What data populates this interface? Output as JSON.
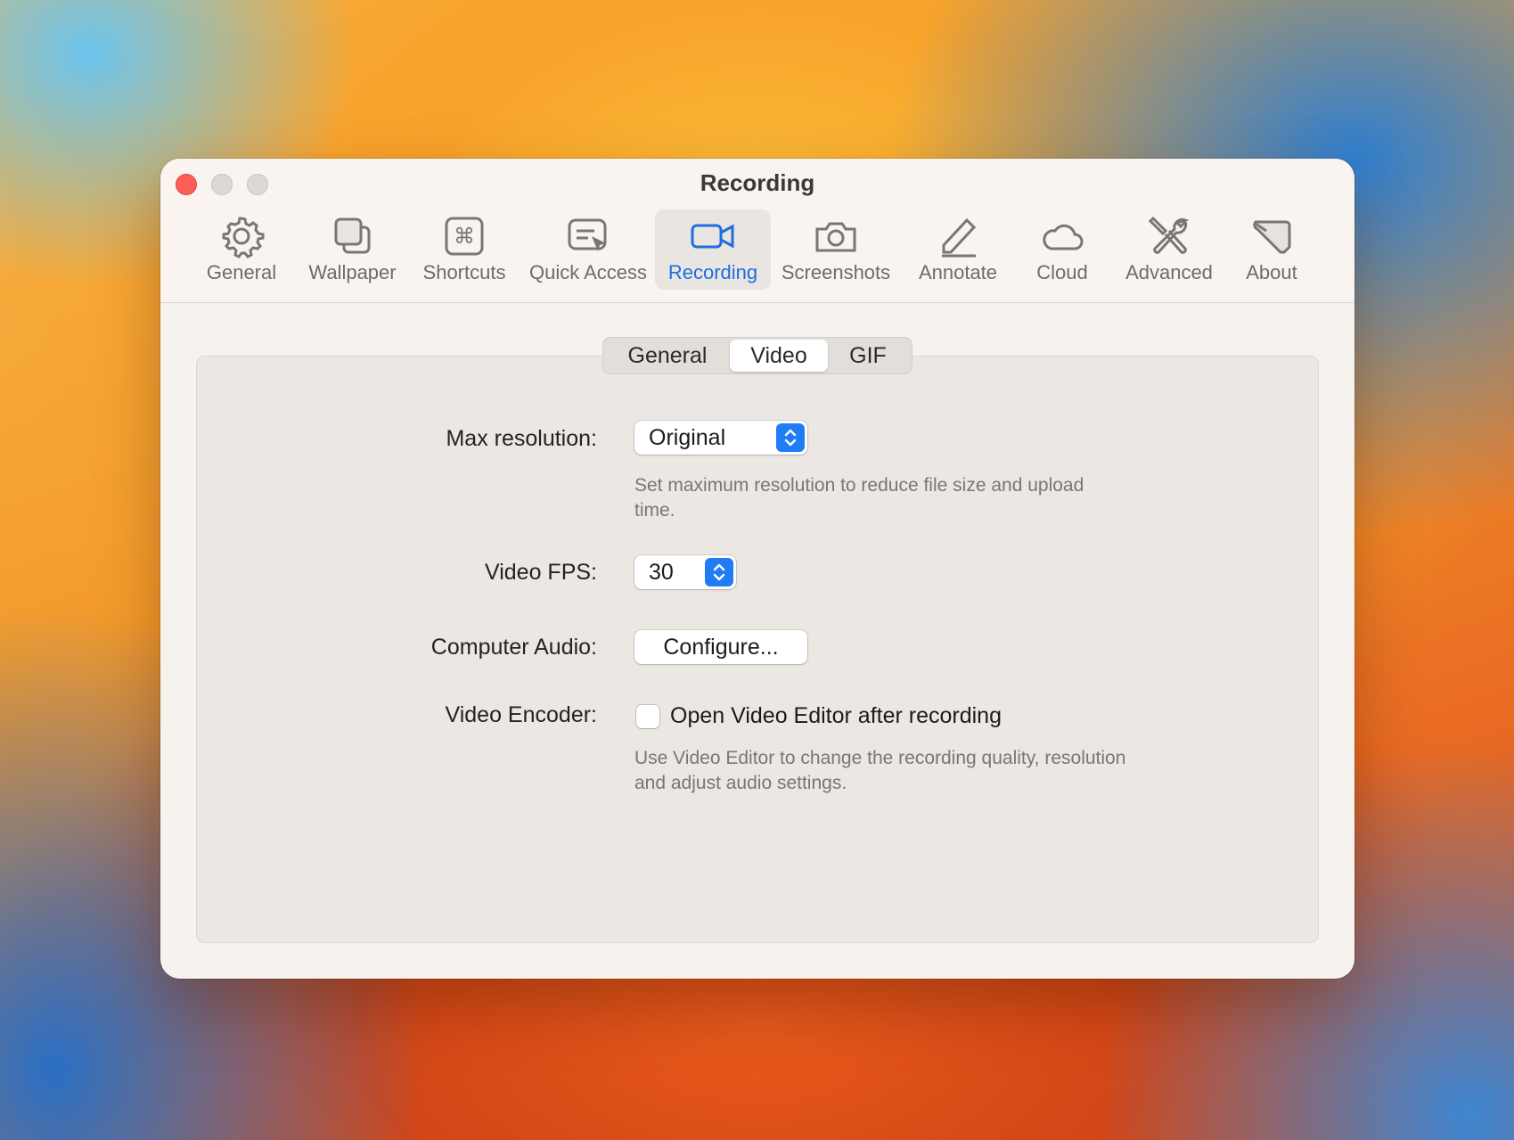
{
  "window": {
    "title": "Recording"
  },
  "toolbar": {
    "items": [
      {
        "label": "General",
        "icon": "gear-icon"
      },
      {
        "label": "Wallpaper",
        "icon": "wallpaper-icon"
      },
      {
        "label": "Shortcuts",
        "icon": "command-icon"
      },
      {
        "label": "Quick Access",
        "icon": "quick-access-icon"
      },
      {
        "label": "Recording",
        "icon": "video-camera-icon",
        "active": true
      },
      {
        "label": "Screenshots",
        "icon": "camera-icon"
      },
      {
        "label": "Annotate",
        "icon": "pencil-icon"
      },
      {
        "label": "Cloud",
        "icon": "cloud-icon"
      },
      {
        "label": "Advanced",
        "icon": "tools-icon"
      },
      {
        "label": "About",
        "icon": "about-icon"
      }
    ]
  },
  "tabs": {
    "items": [
      "General",
      "Video",
      "GIF"
    ],
    "selected": "Video"
  },
  "settings": {
    "max_resolution": {
      "label": "Max resolution:",
      "value": "Original",
      "help": "Set maximum resolution to reduce file size and upload time."
    },
    "video_fps": {
      "label": "Video FPS:",
      "value": "30"
    },
    "computer_audio": {
      "label": "Computer Audio:",
      "button": "Configure..."
    },
    "video_encoder": {
      "label": "Video Encoder:",
      "checkbox_label": "Open Video Editor after recording",
      "checked": false,
      "help": "Use Video Editor to change the recording quality, resolution and adjust audio settings."
    }
  },
  "colors": {
    "accent": "#1d6ee0",
    "close": "#fd5f57",
    "window_bg": "#f6f2ee"
  }
}
